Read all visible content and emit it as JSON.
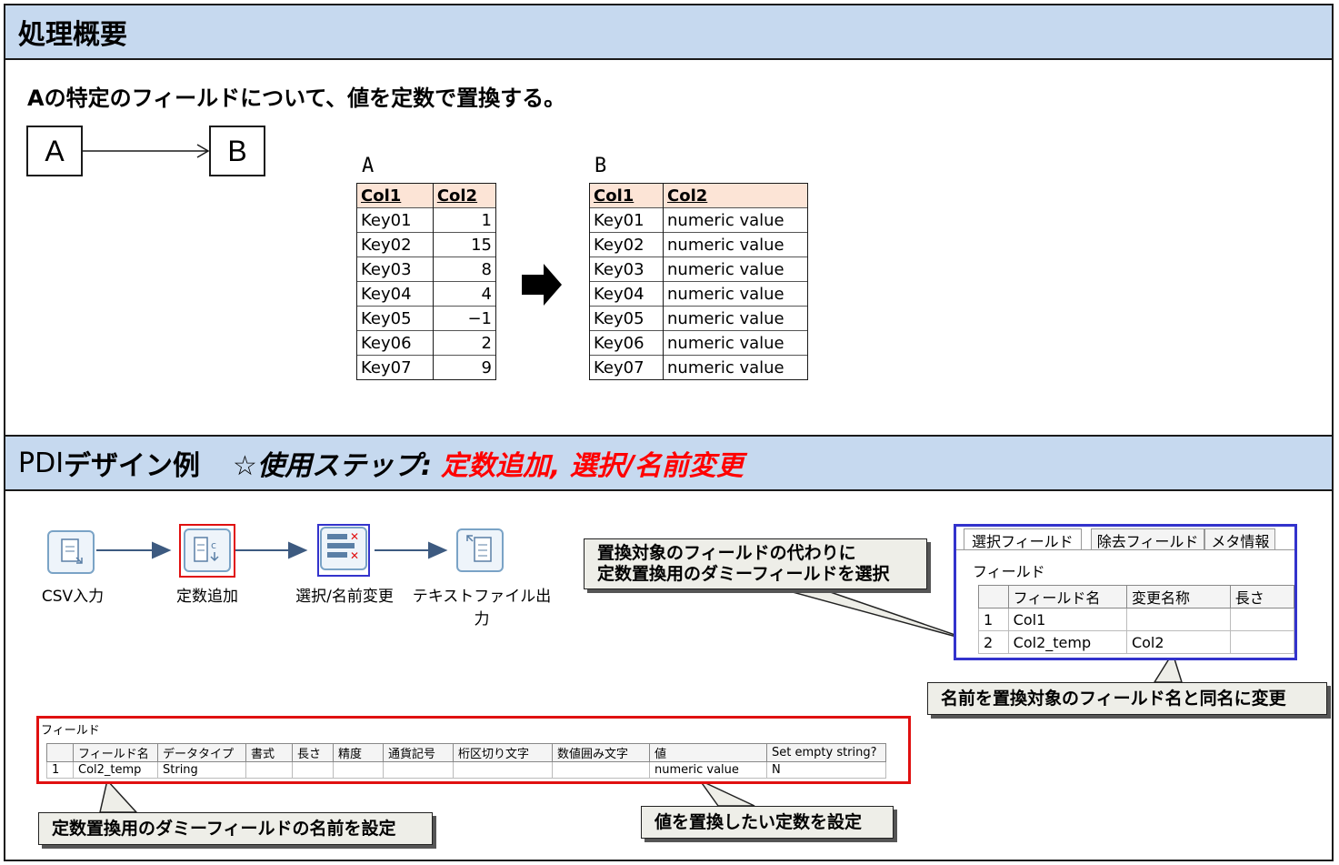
{
  "section1": {
    "title": "処理概要",
    "description": "Aの特定のフィールドについて、値を定数で置換する。",
    "flow": {
      "from": "A",
      "to": "B"
    },
    "table_a": {
      "label": "A",
      "headers": [
        "Col1",
        "Col2"
      ],
      "rows": [
        [
          "Key01",
          "1"
        ],
        [
          "Key02",
          "15"
        ],
        [
          "Key03",
          "8"
        ],
        [
          "Key04",
          "4"
        ],
        [
          "Key05",
          "−1"
        ],
        [
          "Key06",
          "2"
        ],
        [
          "Key07",
          "9"
        ]
      ]
    },
    "table_b": {
      "label": "B",
      "headers": [
        "Col1",
        "Col2"
      ],
      "rows": [
        [
          "Key01",
          "numeric value"
        ],
        [
          "Key02",
          "numeric value"
        ],
        [
          "Key03",
          "numeric value"
        ],
        [
          "Key04",
          "numeric value"
        ],
        [
          "Key05",
          "numeric value"
        ],
        [
          "Key06",
          "numeric value"
        ],
        [
          "Key07",
          "numeric value"
        ]
      ]
    }
  },
  "section2": {
    "title_prefix": "PDI",
    "title_main": "デザイン例",
    "title_steps_label": "☆使用ステップ:",
    "title_steps": "定数追加, 選択/名前変更",
    "steps": [
      {
        "label": "CSV入力",
        "icon": "csv-input-icon"
      },
      {
        "label": "定数追加",
        "icon": "add-constants-icon"
      },
      {
        "label": "選択/名前変更",
        "icon": "select-rename-icon"
      },
      {
        "label": "テキストファイル出力",
        "icon": "text-file-output-icon"
      }
    ],
    "callout_select": [
      "置換対象のフィールドの代わりに",
      "定数置換用のダミーフィールドを選択"
    ],
    "callout_rename": "名前を置換対象のフィールド名と同名に変更",
    "callout_fieldname": "定数置換用のダミーフィールドの名前を設定",
    "callout_value": "値を置換したい定数を設定",
    "select_panel": {
      "tabs": [
        "選択フィールド",
        "除去フィールド",
        "メタ情報"
      ],
      "section_label": "フィールド",
      "headers": [
        "",
        "フィールド名",
        "変更名称",
        "長さ"
      ],
      "rows": [
        [
          "1",
          "Col1",
          "",
          ""
        ],
        [
          "2",
          "Col2_temp",
          "Col2",
          ""
        ]
      ]
    },
    "field_panel": {
      "section_label": "フィールド",
      "headers": [
        "",
        "フィールド名",
        "データタイプ",
        "書式",
        "長さ",
        "精度",
        "通貨記号",
        "桁区切り文字",
        "数値囲み文字",
        "値",
        "Set empty string?"
      ],
      "rows": [
        [
          "1",
          "Col2_temp",
          "String",
          "",
          "",
          "",
          "",
          "",
          "",
          "numeric value",
          "N"
        ]
      ]
    },
    "colors": {
      "highlight_red": "#e01010",
      "highlight_blue": "#3333cc",
      "header_bg": "#c6d9ef",
      "table_header_bg": "#fce4d6"
    }
  }
}
